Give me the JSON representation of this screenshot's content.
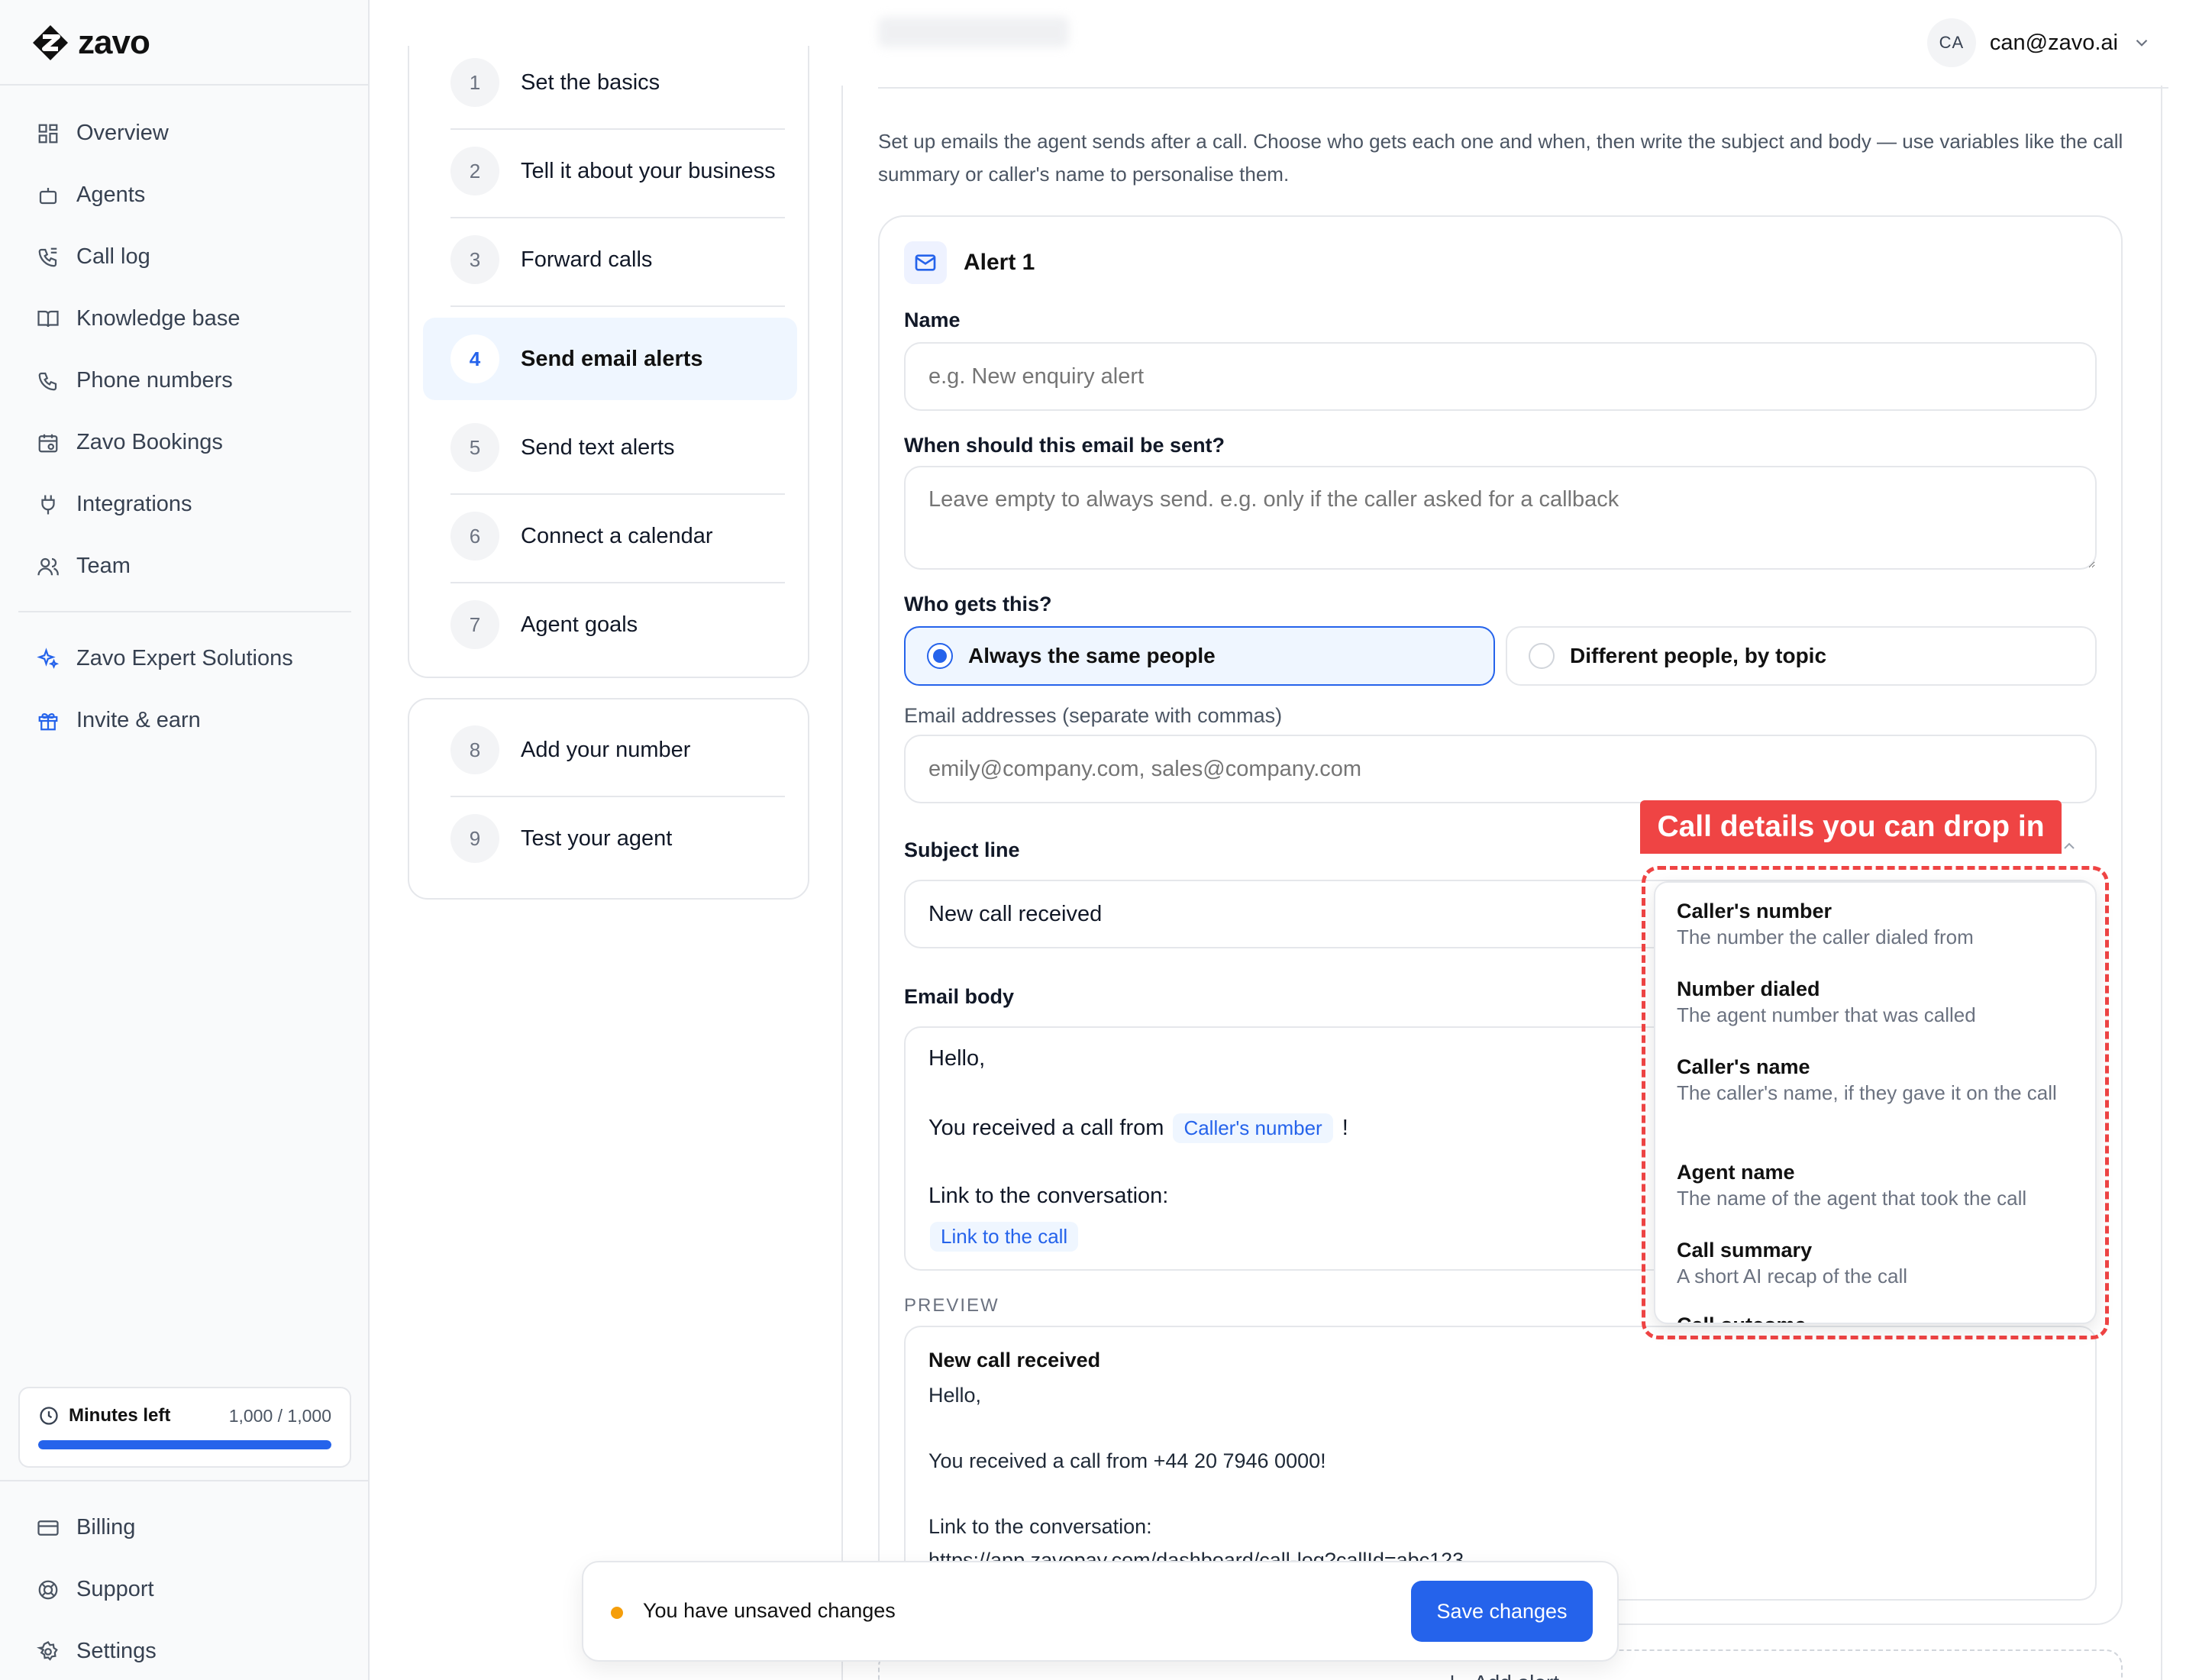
{
  "app": {
    "brand": "zavo",
    "user_initials": "CA",
    "user_email": "can@zavo.ai"
  },
  "nav": {
    "items": [
      {
        "label": "Overview",
        "icon": "grid-icon"
      },
      {
        "label": "Agents",
        "icon": "bot-icon"
      },
      {
        "label": "Call log",
        "icon": "phone-log-icon"
      },
      {
        "label": "Knowledge base",
        "icon": "book-icon"
      },
      {
        "label": "Phone numbers",
        "icon": "phone-icon"
      },
      {
        "label": "Zavo Bookings",
        "icon": "calendar-icon"
      },
      {
        "label": "Integrations",
        "icon": "plug-icon"
      },
      {
        "label": "Team",
        "icon": "users-icon"
      }
    ],
    "extra": [
      {
        "label": "Zavo Expert Solutions",
        "icon": "sparkles-icon"
      },
      {
        "label": "Invite & earn",
        "icon": "gift-icon"
      }
    ],
    "bottom": [
      {
        "label": "Billing",
        "icon": "card-icon"
      },
      {
        "label": "Support",
        "icon": "lifebuoy-icon"
      },
      {
        "label": "Settings",
        "icon": "gear-icon"
      }
    ],
    "minutes": {
      "label": "Minutes left",
      "value": "1,000 / 1,000",
      "fraction": 1.0
    }
  },
  "steps": [
    {
      "num": "1",
      "label": "Set the basics"
    },
    {
      "num": "2",
      "label": "Tell it about your business"
    },
    {
      "num": "3",
      "label": "Forward calls"
    },
    {
      "num": "4",
      "label": "Send email alerts",
      "active": true
    },
    {
      "num": "5",
      "label": "Send text alerts"
    },
    {
      "num": "6",
      "label": "Connect a calendar"
    },
    {
      "num": "7",
      "label": "Agent goals"
    },
    {
      "num": "8",
      "label": "Add your number"
    },
    {
      "num": "9",
      "label": "Test your agent"
    }
  ],
  "main": {
    "intro": "Set up emails the agent sends after a call. Choose who gets each one and when, then write the subject and body — use variables like the call summary or caller's name to personalise them.",
    "alert_title": "Alert 1",
    "name_label": "Name",
    "name_placeholder": "e.g. New enquiry alert",
    "condition_label": "When should this email be sent?",
    "condition_placeholder": "Leave empty to always send. e.g. only if the caller asked for a callback",
    "recipients_label": "Who gets this?",
    "option_same": "Always the same people",
    "option_topic": "Different people, by topic",
    "emails_label": "Email addresses (separate with commas)",
    "emails_placeholder": "emily@company.com, sales@company.com",
    "subject_label": "Subject line",
    "subject_value": "New call received",
    "body_label": "Email body",
    "body": {
      "greeting": "Hello,",
      "received_prefix": "You received a call from",
      "caller_chip": "Caller's number",
      "received_suffix": "!",
      "link_line": "Link to the conversation:",
      "link_chip": "Link to the call"
    },
    "preview_label": "PREVIEW",
    "preview": {
      "subject": "New call received",
      "greeting": "Hello,",
      "received": "You received a call from +44 20 7946 0000!",
      "link_line": "Link to the conversation:",
      "url": "https://app.zavopay.com/dashboard/call-log?callId=abc123"
    },
    "add_alert": "Add alert"
  },
  "dropdown": {
    "tag": "Call details you can drop in",
    "items": [
      {
        "name": "Caller's number",
        "desc": "The number the caller dialed from"
      },
      {
        "name": "Number dialed",
        "desc": "The agent number that was called"
      },
      {
        "name": "Caller's name",
        "desc": "The caller's name, if they gave it on the call"
      },
      {
        "name": "Agent name",
        "desc": "The name of the agent that took the call"
      },
      {
        "name": "Call summary",
        "desc": "A short AI recap of the call"
      },
      {
        "name": "Call outcome",
        "desc": ""
      }
    ]
  },
  "toast": {
    "text": "You have unsaved changes",
    "save": "Save changes"
  },
  "colors": {
    "accent": "#2563eb",
    "highlight": "#ef4444",
    "warning_dot": "#f59e0b"
  }
}
